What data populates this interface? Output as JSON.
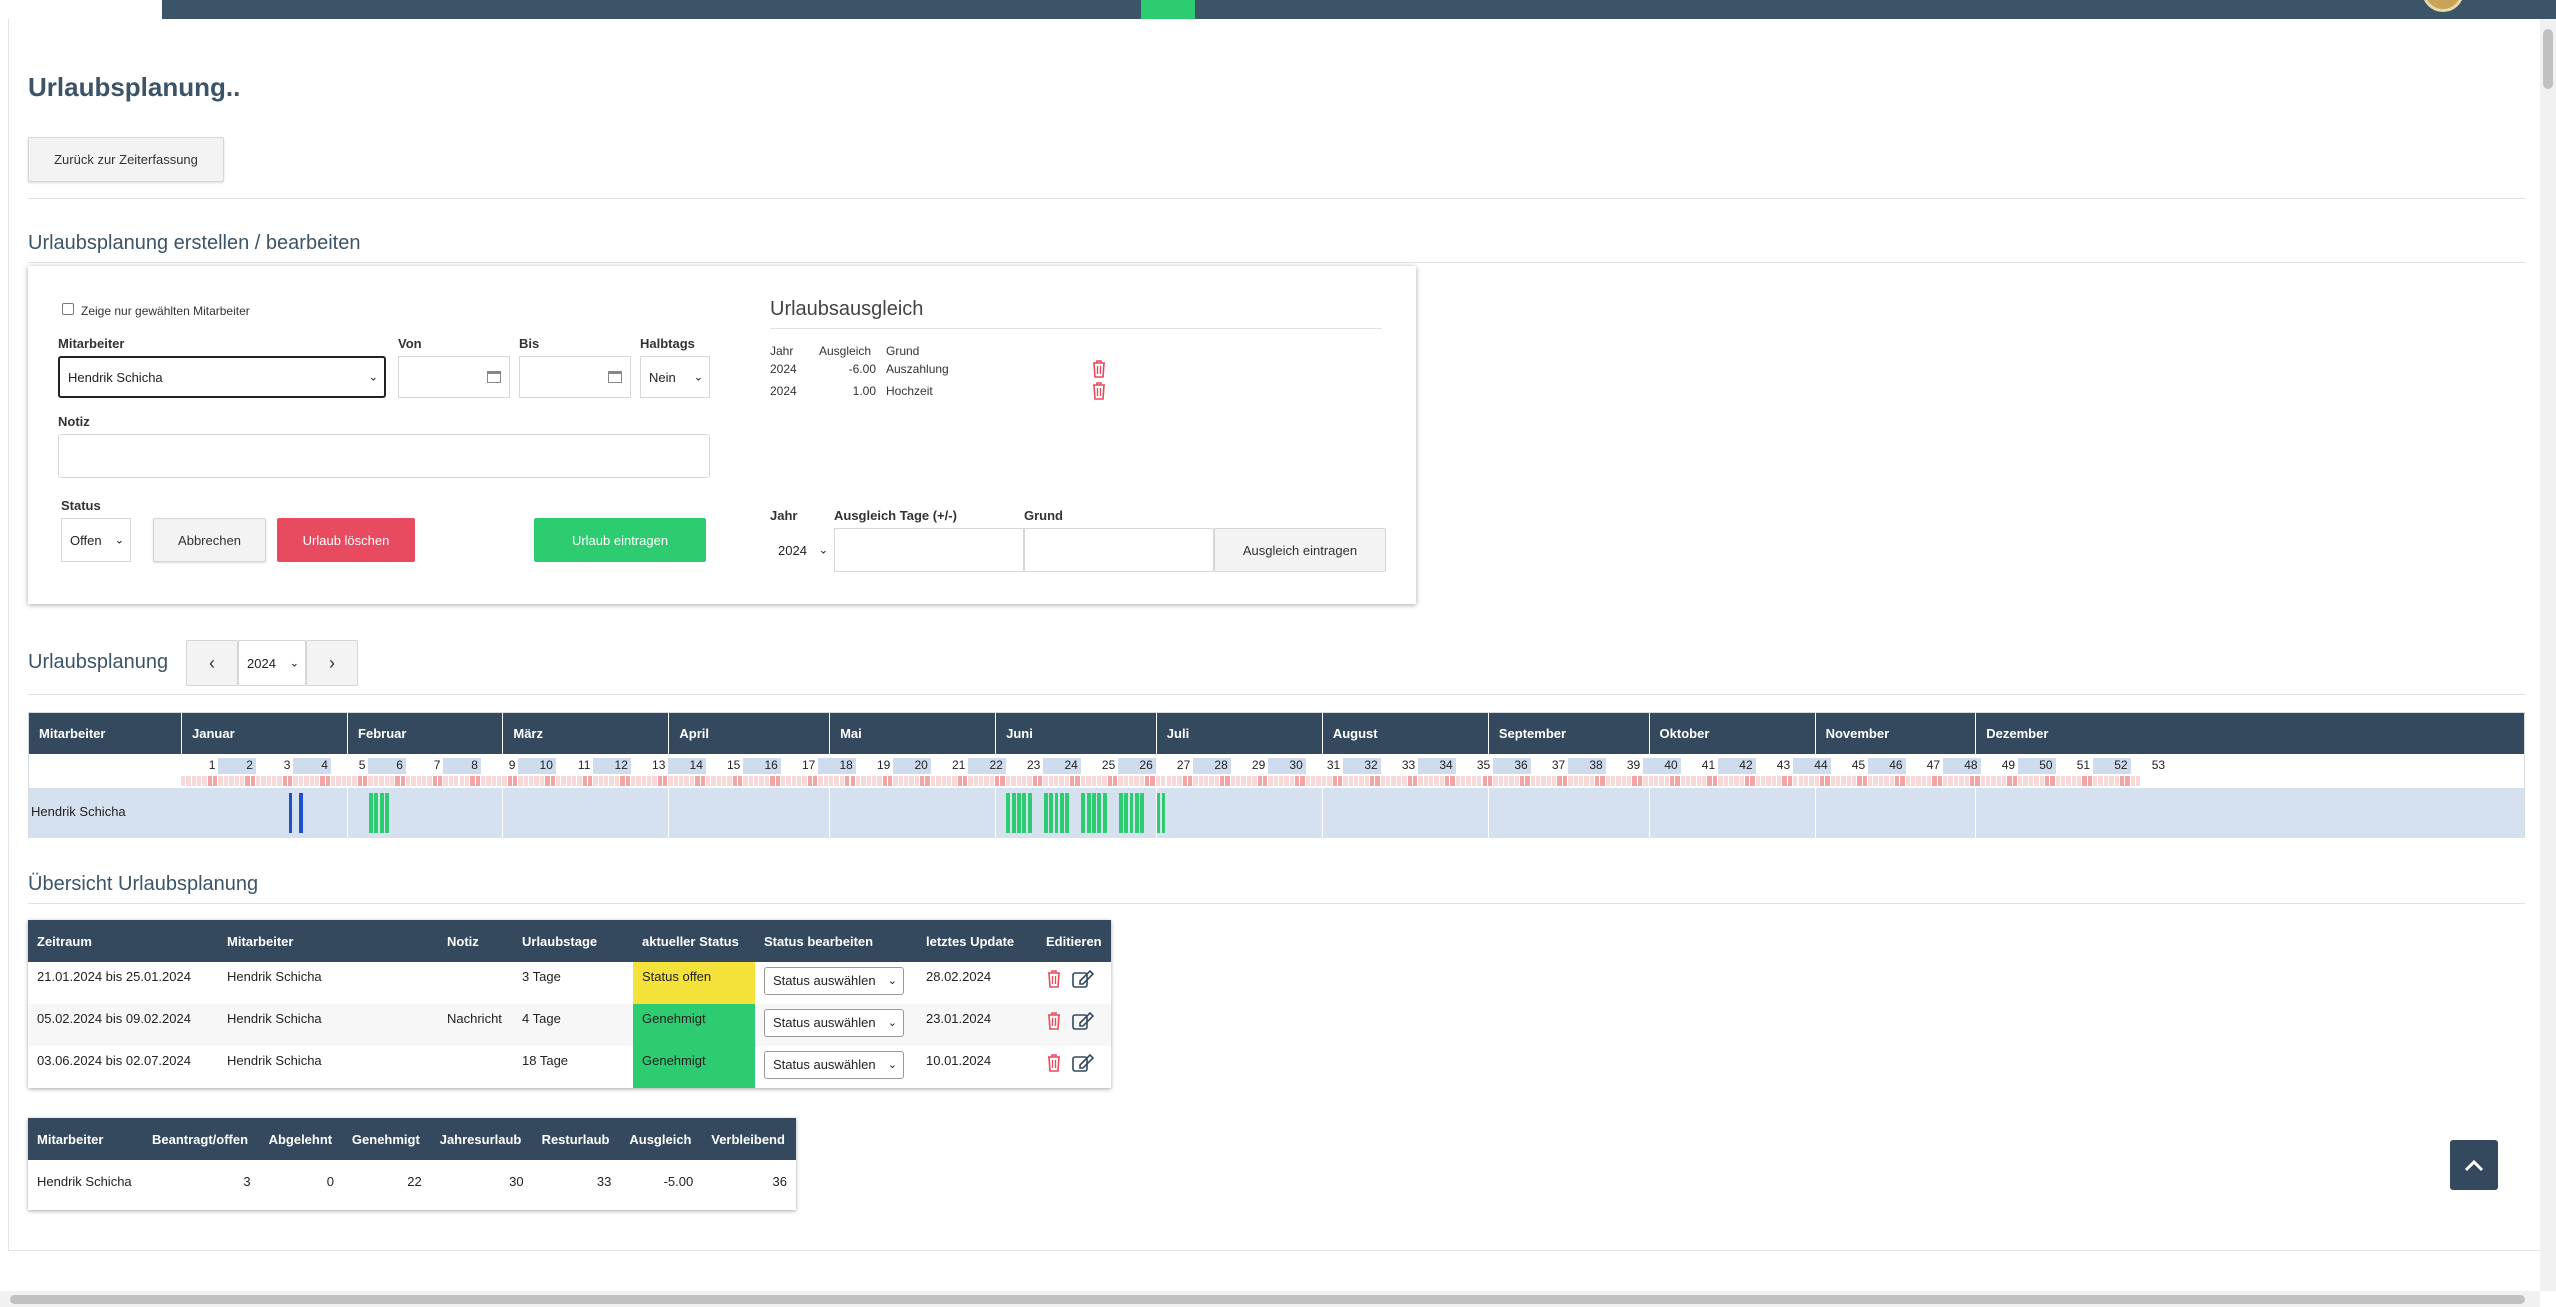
{
  "page_title": "Urlaubsplanung..",
  "back_button": "Zurück zur Zeiterfassung",
  "edit_section": {
    "title": "Urlaubsplanung erstellen / bearbeiten",
    "checkbox_label": "Zeige nur gewählten Mitarbeiter",
    "employee_label": "Mitarbeiter",
    "employee_value": "Hendrik Schicha",
    "from_label": "Von",
    "to_label": "Bis",
    "halfday_label": "Halbtags",
    "halfday_value": "Nein",
    "note_label": "Notiz",
    "status_label": "Status",
    "status_value": "Offen",
    "cancel_button": "Abbrechen",
    "delete_button": "Urlaub löschen",
    "submit_button": "Urlaub eintragen"
  },
  "balance": {
    "title": "Urlaubsausgleich",
    "headers": [
      "Jahr",
      "Ausgleich",
      "Grund"
    ],
    "rows": [
      {
        "year": "2024",
        "value": "-6.00",
        "reason": "Auszahlung"
      },
      {
        "year": "2024",
        "value": "1.00",
        "reason": "Hochzeit"
      }
    ],
    "form_year_label": "Jahr",
    "form_days_label": "Ausgleich Tage (+/-)",
    "form_reason_label": "Grund",
    "form_year_value": "2024",
    "form_submit": "Ausgleich eintragen"
  },
  "planning": {
    "title": "Urlaubsplanung",
    "prev": "‹",
    "next": "›",
    "year": "2024",
    "employee_header": "Mitarbeiter",
    "months": [
      "Januar",
      "Februar",
      "März",
      "April",
      "Mai",
      "Juni",
      "Juli",
      "August",
      "September",
      "Oktober",
      "November",
      "Dezember"
    ],
    "weeks": [
      "1",
      "2",
      "3",
      "4",
      "5",
      "6",
      "7",
      "8",
      "9",
      "10",
      "11",
      "12",
      "13",
      "14",
      "15",
      "16",
      "17",
      "18",
      "19",
      "20",
      "21",
      "22",
      "23",
      "24",
      "25",
      "26",
      "27",
      "28",
      "29",
      "30",
      "31",
      "32",
      "33",
      "34",
      "35",
      "36",
      "37",
      "38",
      "39",
      "40",
      "41",
      "42",
      "43",
      "44",
      "45",
      "46",
      "47",
      "48",
      "49",
      "50",
      "51",
      "52",
      "53"
    ],
    "employee": "Hendrik Schicha",
    "colors": {
      "open": "#1f4fd1",
      "approved": "#2ecc71"
    }
  },
  "overview": {
    "title": "Übersicht Urlaubsplanung",
    "headers": [
      "Zeitraum",
      "Mitarbeiter",
      "Notiz",
      "Urlaubstage",
      "aktueller Status",
      "Status bearbeiten",
      "letztes Update",
      "Editieren"
    ],
    "rows": [
      {
        "period": "21.01.2024 bis 25.01.2024",
        "employee": "Hendrik Schicha",
        "note": "",
        "days": "3 Tage",
        "status": "Status offen",
        "select": "Status auswählen",
        "updated": "28.02.2024"
      },
      {
        "period": "05.02.2024 bis 09.02.2024",
        "employee": "Hendrik Schicha",
        "note": "Nachricht",
        "days": "4 Tage",
        "status": "Genehmigt",
        "select": "Status auswählen",
        "updated": "23.01.2024"
      },
      {
        "period": "03.06.2024 bis 02.07.2024",
        "employee": "Hendrik Schicha",
        "note": "",
        "days": "18 Tage",
        "status": "Genehmigt",
        "select": "Status auswählen",
        "updated": "10.01.2024"
      }
    ]
  },
  "summary": {
    "headers": [
      "Mitarbeiter",
      "Beantragt/offen",
      "Abgelehnt",
      "Genehmigt",
      "Jahresurlaub",
      "Resturlaub",
      "Ausgleich",
      "Verbleibend"
    ],
    "row": {
      "employee": "Hendrik Schicha",
      "requested": "3",
      "rejected": "0",
      "approved": "22",
      "annual": "30",
      "remaining": "33",
      "balance": "-5.00",
      "left": "36"
    }
  },
  "scroll_top_icon": "chevron-up-icon"
}
